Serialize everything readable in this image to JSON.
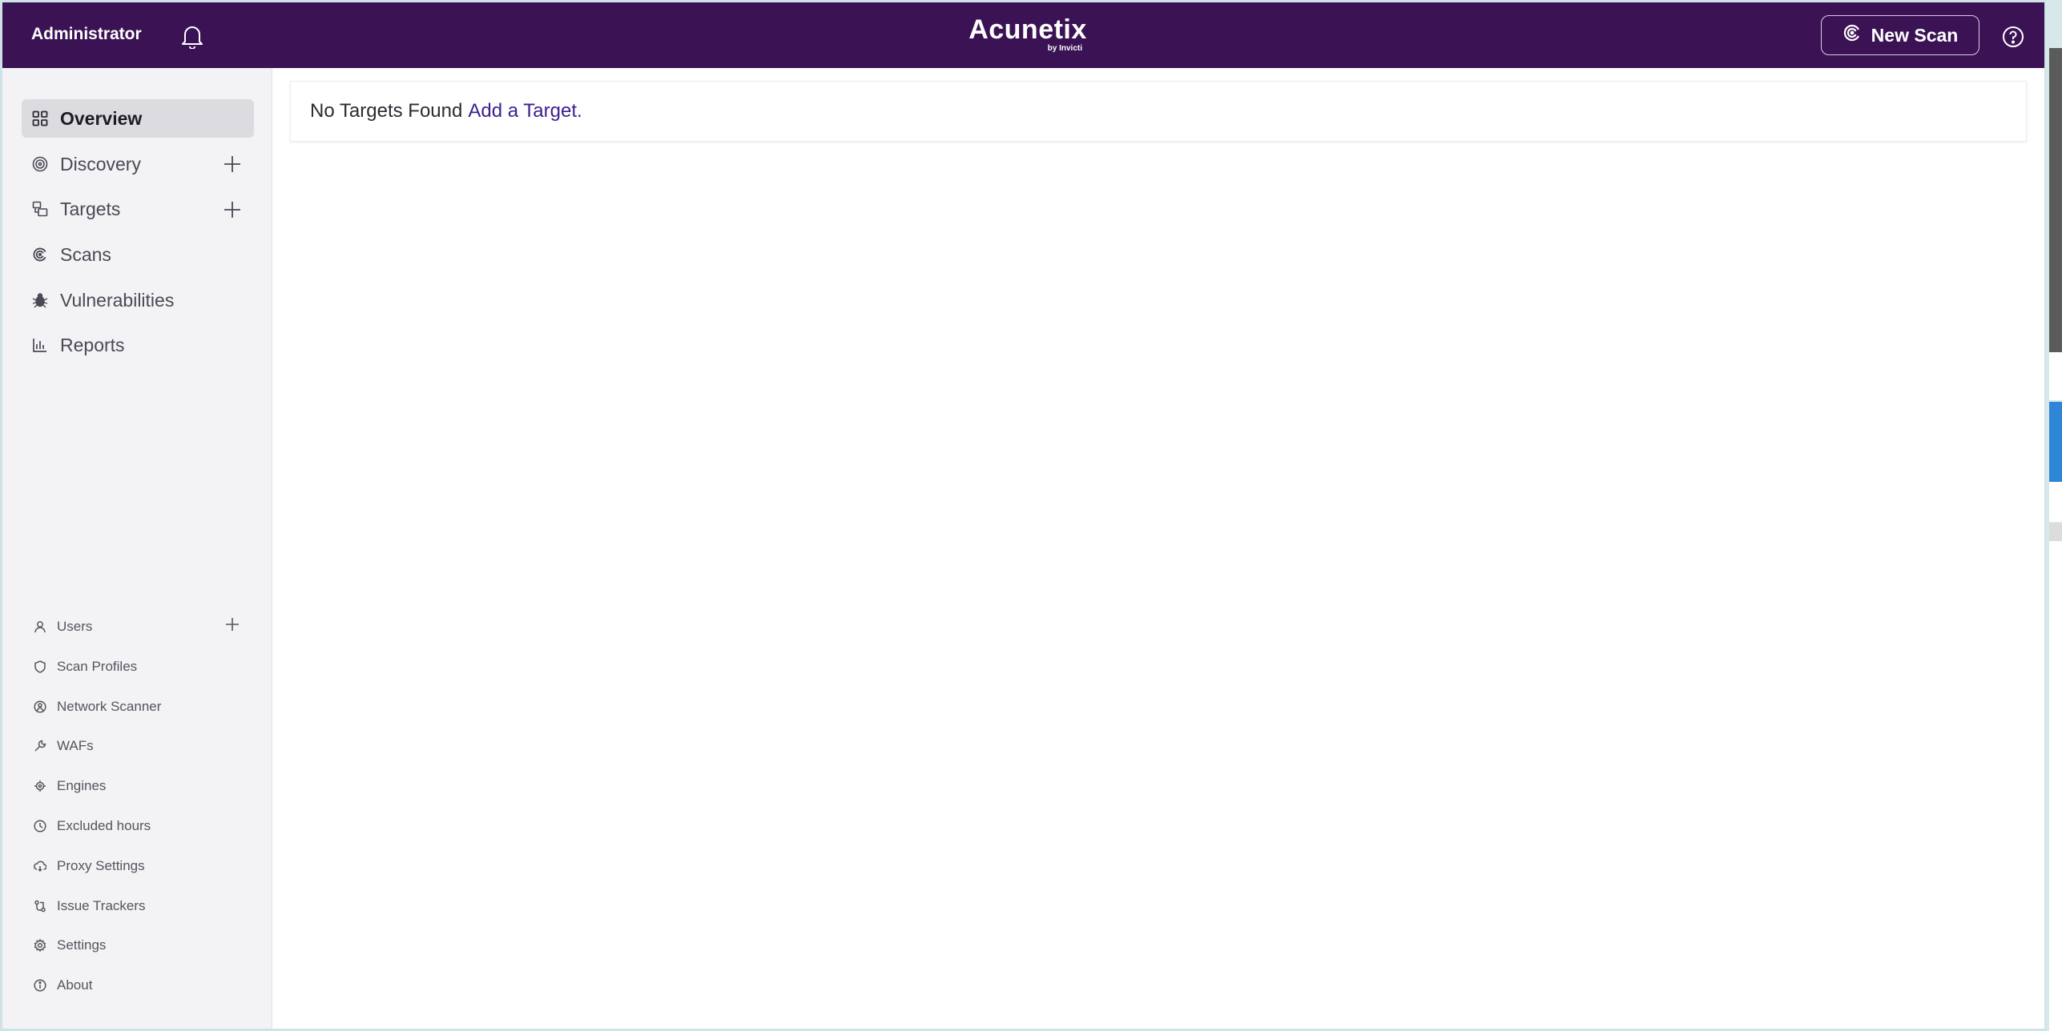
{
  "header": {
    "user": "Administrator",
    "brand_name": "Acunetix",
    "brand_sub": "by Invicti",
    "new_scan_label": "New Scan"
  },
  "sidebar": {
    "main_items": [
      {
        "label": "Overview",
        "icon": "grid-icon",
        "active": true
      },
      {
        "label": "Discovery",
        "icon": "target-icon"
      },
      {
        "label": "Targets",
        "icon": "targets-icon"
      },
      {
        "label": "Scans",
        "icon": "scan-icon"
      },
      {
        "label": "Vulnerabilities",
        "icon": "bug-icon"
      },
      {
        "label": "Reports",
        "icon": "chart-icon"
      }
    ],
    "settings_items": [
      {
        "label": "Users",
        "icon": "user-icon"
      },
      {
        "label": "Scan Profiles",
        "icon": "shield-icon"
      },
      {
        "label": "Network Scanner",
        "icon": "network-icon"
      },
      {
        "label": "WAFs",
        "icon": "wrench-icon"
      },
      {
        "label": "Engines",
        "icon": "engine-icon"
      },
      {
        "label": "Excluded hours",
        "icon": "clock-icon"
      },
      {
        "label": "Proxy Settings",
        "icon": "cloud-icon"
      },
      {
        "label": "Issue Trackers",
        "icon": "tracker-icon"
      },
      {
        "label": "Settings",
        "icon": "gear-icon"
      },
      {
        "label": "About",
        "icon": "info-icon"
      }
    ]
  },
  "main": {
    "notice_text": "No Targets Found",
    "notice_link": "Add a Target."
  },
  "colors": {
    "header_bg": "#3b1354",
    "link": "#3b1f8f",
    "sidebar_bg": "#f3f2f5"
  }
}
